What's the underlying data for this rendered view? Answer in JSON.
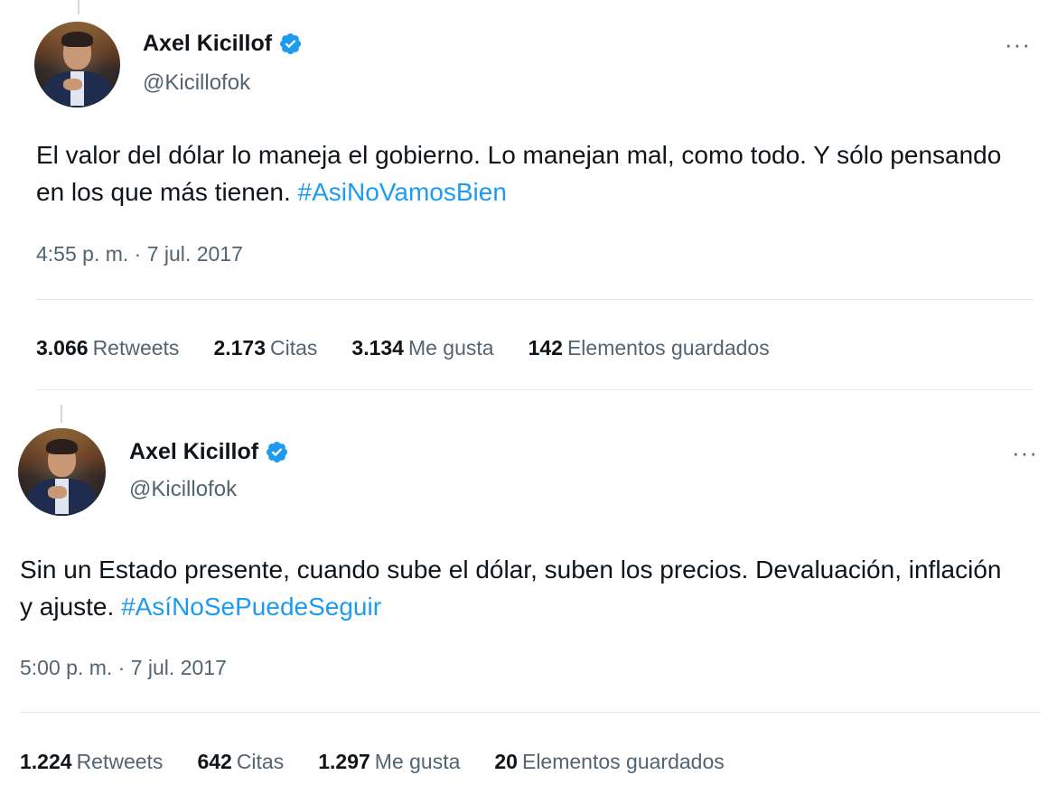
{
  "tweets": [
    {
      "author": {
        "name": "Axel Kicillof",
        "handle": "@Kicillofok",
        "verified": true
      },
      "text": "El valor del dólar lo maneja el gobierno. Lo manejan mal, como todo. Y sólo pensando en los que más tienen. ",
      "hashtag": "#AsiNoVamosBien",
      "timestamp": "4:55 p. m. · 7 jul. 2017",
      "more_icon": "···",
      "stats": [
        {
          "value": "3.066",
          "label": "Retweets"
        },
        {
          "value": "2.173",
          "label": "Citas"
        },
        {
          "value": "3.134",
          "label": "Me gusta"
        },
        {
          "value": "142",
          "label": "Elementos guardados"
        }
      ]
    },
    {
      "author": {
        "name": "Axel Kicillof",
        "handle": "@Kicillofok",
        "verified": true
      },
      "text": "Sin un Estado presente, cuando sube el dólar, suben los precios. Devaluación, inflación y ajuste. ",
      "hashtag": "#AsíNoSePuedeSeguir",
      "timestamp": "5:00 p. m. · 7 jul. 2017",
      "more_icon": "···",
      "stats": [
        {
          "value": "1.224",
          "label": "Retweets"
        },
        {
          "value": "642",
          "label": "Citas"
        },
        {
          "value": "1.297",
          "label": "Me gusta"
        },
        {
          "value": "20",
          "label": "Elementos guardados"
        }
      ]
    }
  ],
  "colors": {
    "accent": "#1d9bf0",
    "secondary_text": "#536471",
    "divider": "#e7e9ea"
  },
  "icons": {
    "verified": "verified-badge-icon",
    "more": "more-options-icon"
  }
}
